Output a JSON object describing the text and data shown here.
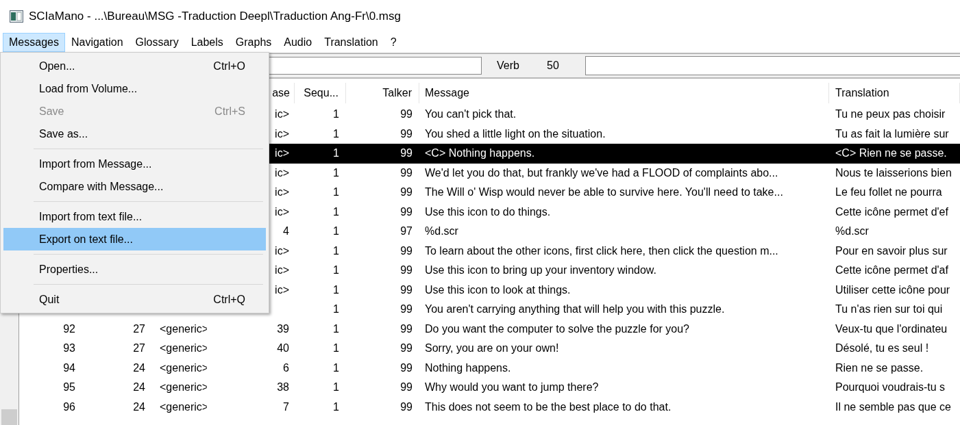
{
  "window": {
    "title": "SCIaMano - ...\\Bureau\\MSG -Traduction Deepl\\Traduction Ang-Fr\\0.msg"
  },
  "menu_bar": [
    {
      "label": "Messages",
      "selected": true
    },
    {
      "label": "Navigation",
      "selected": false
    },
    {
      "label": "Glossary",
      "selected": false
    },
    {
      "label": "Labels",
      "selected": false
    },
    {
      "label": "Graphs",
      "selected": false
    },
    {
      "label": "Audio",
      "selected": false
    },
    {
      "label": "Translation",
      "selected": false
    },
    {
      "label": "?",
      "selected": false
    }
  ],
  "toolbar": {
    "verb_label": "Verb",
    "verb_number": "50"
  },
  "table": {
    "columns": [
      "ase",
      "Sequ...",
      "Talker",
      "Message",
      "Translation"
    ],
    "rows": [
      {
        "column_4": "ic>",
        "sequence": "1",
        "talker": "99",
        "message": "You can't pick that.",
        "translation": "Tu ne peux pas choisir",
        "selected": false
      },
      {
        "column_4": "ic>",
        "sequence": "1",
        "talker": "99",
        "message": "You shed a little light on the situation.",
        "translation": "Tu as fait la lumière sur",
        "selected": false
      },
      {
        "column_4": "ic>",
        "sequence": "1",
        "talker": "99",
        "message": "<C> Nothing happens.",
        "translation": "<C> Rien ne se passe.",
        "selected": true
      },
      {
        "column_4": "ic>",
        "sequence": "1",
        "talker": "99",
        "message": "We'd let you do that, but frankly we've had a FLOOD of complaints abo...",
        "translation": "Nous te laisserions bien",
        "selected": false
      },
      {
        "column_4": "ic>",
        "sequence": "1",
        "talker": "99",
        "message": "The Will o' Wisp would never be able to survive here.  You'll need to take...",
        "translation": "Le feu follet ne pourra",
        "selected": false
      },
      {
        "column_4": "ic>",
        "sequence": "1",
        "talker": "99",
        "message": "Use this icon to do things.",
        "translation": "Cette icône permet d'ef",
        "selected": false
      },
      {
        "column_4": "4",
        "sequence": "1",
        "talker": "97",
        "message": "%d.scr",
        "translation": "%d.scr",
        "selected": false
      },
      {
        "column_4": "ic>",
        "sequence": "1",
        "talker": "99",
        "message": "To learn about the other icons, first click here, then click the question m...",
        "translation": "Pour en savoir plus sur",
        "selected": false
      },
      {
        "column_4": "ic>",
        "sequence": "1",
        "talker": "99",
        "message": "Use this icon to bring up your inventory window.",
        "translation": "Cette icône permet d'af",
        "selected": false
      },
      {
        "column_4": "ic>",
        "sequence": "1",
        "talker": "99",
        "message": "Use this icon to look at things.",
        "translation": "Utiliser cette icône pour",
        "selected": false
      },
      {
        "sequence": "1",
        "talker": "99",
        "message": "You aren't carrying anything that will help you with this puzzle.",
        "translation": "Tu n'as rien sur toi qui",
        "selected": false
      },
      {
        "column_1": "92",
        "column_2": "27",
        "column_3": "<generic>",
        "column_4": "39",
        "sequence": "1",
        "talker": "99",
        "message": "Do you want the computer to solve the puzzle for you?",
        "translation": "Veux-tu que l'ordinateu",
        "selected": false
      },
      {
        "column_1": "93",
        "column_2": "27",
        "column_3": "<generic>",
        "column_4": "40",
        "sequence": "1",
        "talker": "99",
        "message": "Sorry, you are on your own!",
        "translation": "Désolé, tu es seul !",
        "selected": false
      },
      {
        "column_1": "94",
        "column_2": "24",
        "column_3": "<generic>",
        "column_4": "6",
        "sequence": "1",
        "talker": "99",
        "message": "Nothing happens.",
        "translation": "Rien ne se passe.",
        "selected": false
      },
      {
        "column_1": "95",
        "column_2": "24",
        "column_3": "<generic>",
        "column_4": "38",
        "sequence": "1",
        "talker": "99",
        "message": "Why would you want to jump there?",
        "translation": "Pourquoi voudrais-tu s",
        "selected": false
      },
      {
        "column_1": "96",
        "column_2": "24",
        "column_3": "<generic>",
        "column_4": "7",
        "sequence": "1",
        "talker": "99",
        "message": "This does not seem to be the best place to do that.",
        "translation": "Il ne semble pas que ce",
        "selected": false
      }
    ]
  },
  "dropdown_menu": [
    {
      "kind": "item",
      "label": "Open...",
      "shortcut": "Ctrl+O",
      "disabled": false,
      "selected": false
    },
    {
      "kind": "item",
      "label": "Load from Volume...",
      "disabled": false,
      "selected": false
    },
    {
      "kind": "item",
      "label": "Save",
      "shortcut": "Ctrl+S",
      "disabled": true,
      "selected": false
    },
    {
      "kind": "item",
      "label": "Save as...",
      "disabled": false,
      "selected": false
    },
    {
      "kind": "separator"
    },
    {
      "kind": "item",
      "label": "Import from Message...",
      "disabled": false,
      "selected": false
    },
    {
      "kind": "item",
      "label": "Compare with Message...",
      "disabled": false,
      "selected": false
    },
    {
      "kind": "separator"
    },
    {
      "kind": "item",
      "label": "Import from text file...",
      "disabled": false,
      "selected": false
    },
    {
      "kind": "item",
      "label": "Export on text file...",
      "disabled": false,
      "selected": true
    },
    {
      "kind": "separator"
    },
    {
      "kind": "item",
      "label": "Properties...",
      "disabled": false,
      "selected": false
    },
    {
      "kind": "separator"
    },
    {
      "kind": "item",
      "label": "Quit",
      "shortcut": "Ctrl+Q",
      "disabled": false,
      "selected": false
    }
  ]
}
